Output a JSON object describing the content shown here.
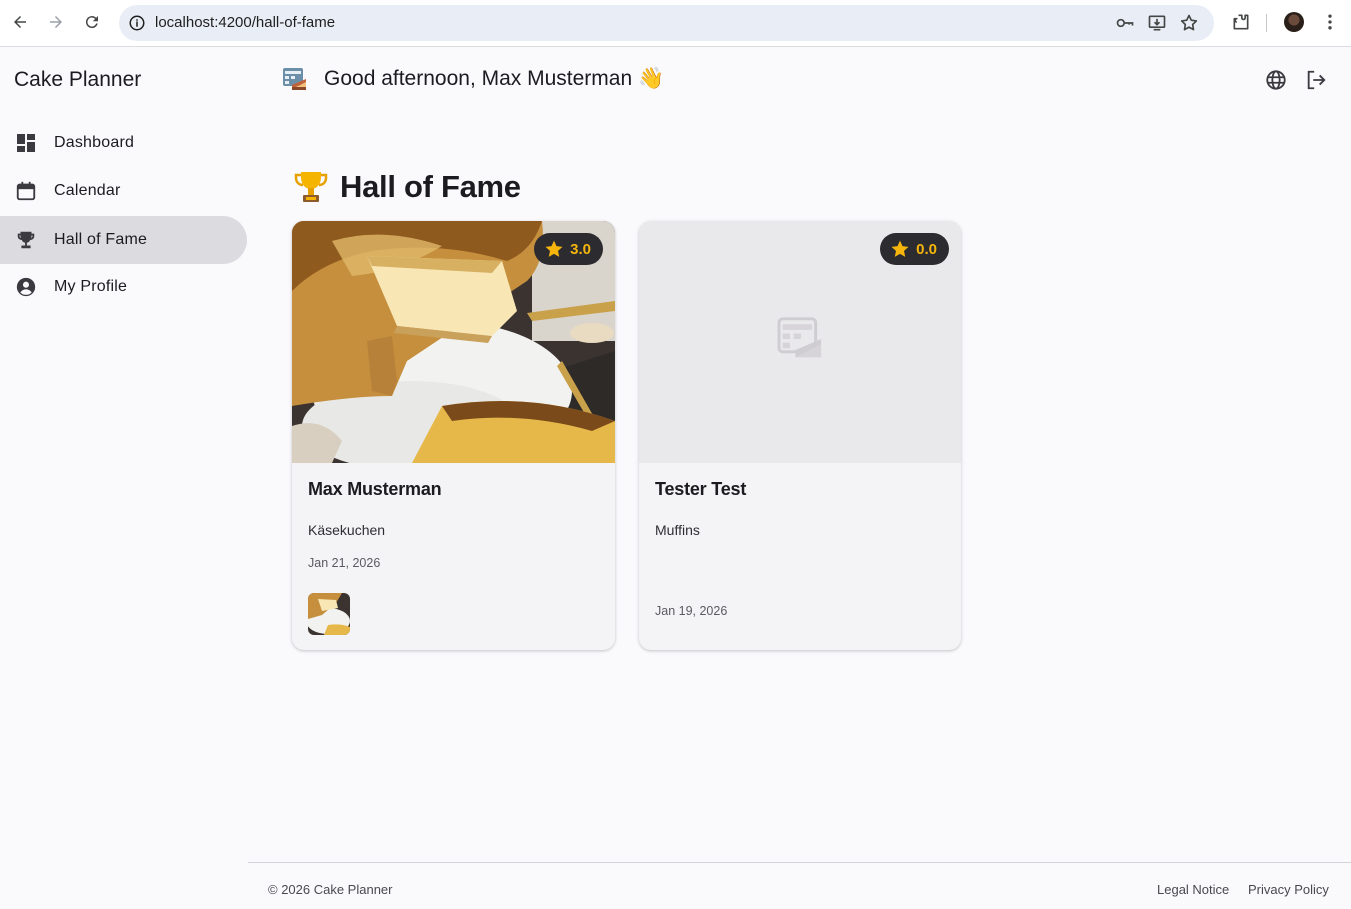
{
  "browser": {
    "url": "localhost:4200/hall-of-fame"
  },
  "sidebar": {
    "title": "Cake Planner",
    "items": [
      {
        "label": "Dashboard",
        "icon": "dashboard-icon",
        "active": false
      },
      {
        "label": "Calendar",
        "icon": "calendar-icon",
        "active": false
      },
      {
        "label": "Hall of Fame",
        "icon": "trophy-icon",
        "active": true
      },
      {
        "label": "My Profile",
        "icon": "account-circle-icon",
        "active": false
      }
    ]
  },
  "topbar": {
    "greeting": "Good afternoon, Max Musterman 👋",
    "actions": [
      "language-icon",
      "logout-icon"
    ]
  },
  "page": {
    "heading": "Hall of Fame",
    "heading_icon": "trophy-emoji"
  },
  "cards": [
    {
      "name": "Max Musterman",
      "cake": "Käsekuchen",
      "date": "Jan 21, 2026",
      "rating": "3.0",
      "has_image": true
    },
    {
      "name": "Tester Test",
      "cake": "Muffins",
      "date": "Jan 19, 2026",
      "rating": "0.0",
      "has_image": false
    }
  ],
  "footer": {
    "copyright": "© 2026 Cake Planner",
    "links": [
      "Legal Notice",
      "Privacy Policy"
    ]
  },
  "colors": {
    "active_nav": "#dcdbe0",
    "rating_star": "#f5b50c",
    "rating_badge": "#2c2b2f",
    "background": "#faf9fc"
  }
}
